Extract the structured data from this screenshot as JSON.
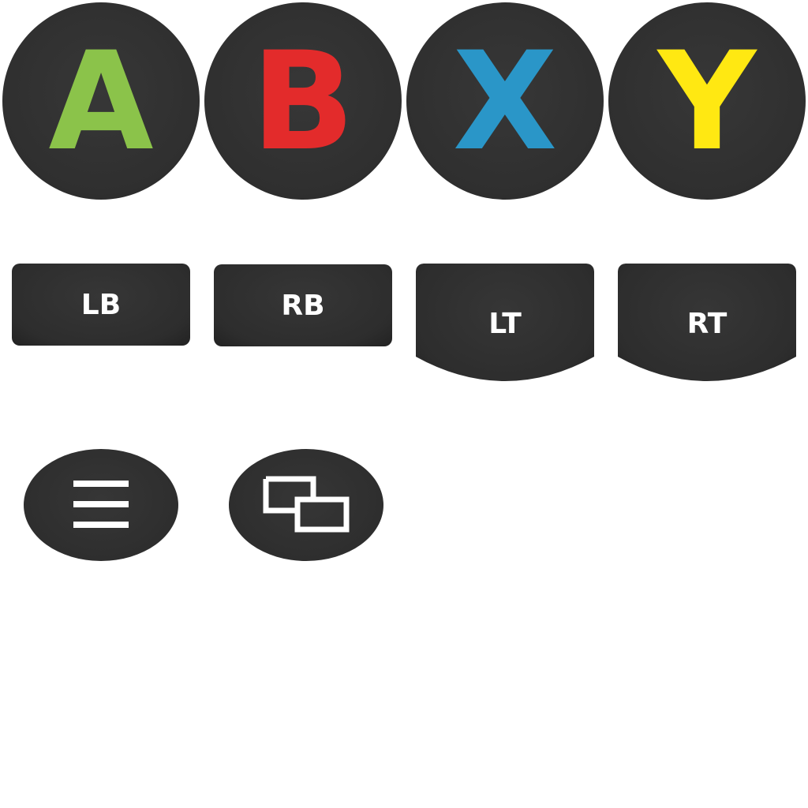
{
  "face_buttons": [
    {
      "label": "A",
      "color": "#8bc34a"
    },
    {
      "label": "B",
      "color": "#e32b2b"
    },
    {
      "label": "X",
      "color": "#2a96c8"
    },
    {
      "label": "Y",
      "color": "#ffe812"
    }
  ],
  "shoulder_buttons": [
    {
      "label": "LB"
    },
    {
      "label": "RB"
    },
    {
      "label": "LT"
    },
    {
      "label": "RT"
    }
  ],
  "center_buttons": [
    {
      "icon": "menu-icon"
    },
    {
      "icon": "view-icon"
    }
  ],
  "colors": {
    "button_body": "#2f2f2f",
    "glyph": "#ffffff"
  }
}
